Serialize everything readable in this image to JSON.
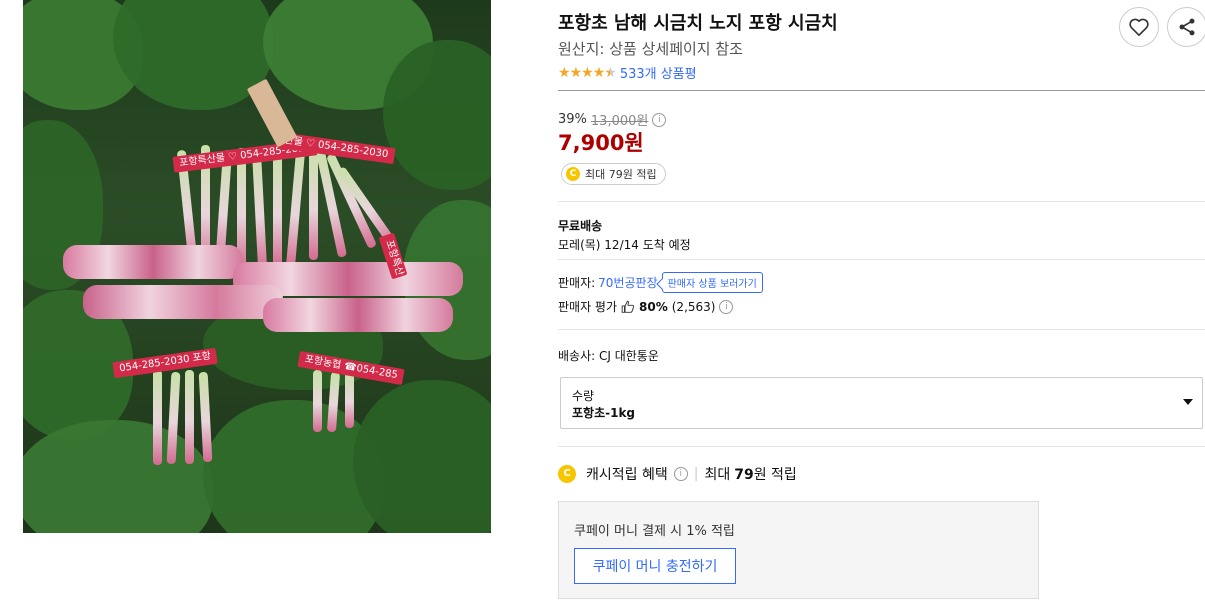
{
  "product": {
    "title": "포항초 남해 시금치 노지 포항 시금치",
    "origin": "원산지: 상품 상세페이지 참조",
    "rating_stars": "★★★★★",
    "review_count": "533개 상품평",
    "rating": 4.5
  },
  "price": {
    "discount_rate": "39%",
    "original_price": "13,000원",
    "sale_price": "7,900원",
    "reward_label": "최대 79원 적립",
    "coin_letter": "C"
  },
  "shipping": {
    "type": "무료배송",
    "arrival": "모레(목) 12/14 도착 예정"
  },
  "seller": {
    "label": "판매자:",
    "name": "70번공판장",
    "view_products": "판매자 상품 보러가기",
    "rating_label": "판매자 평가",
    "rating_percent": "80%",
    "rating_count": "(2,563)"
  },
  "carrier": "배송사: CJ 대한통운",
  "option": {
    "label": "수량",
    "value": "포항초-1kg"
  },
  "cash_reward": {
    "title": "캐시적립 혜택",
    "max": "최대",
    "amount": "79",
    "suffix": "원 적립",
    "coupay_desc": "쿠페이 머니 결제 시 1% 적립",
    "charge_button": "쿠페이 머니 충전하기"
  },
  "image_text": {
    "band1": "포항특산물 ♡ 054-285-2030",
    "band2": "산물 ♡ 054-285-2030",
    "band3": "054-285-2030 포항",
    "band4": "포항농협 ☎054-285",
    "band5": "포항특산"
  },
  "colors": {
    "accent": "#346aff",
    "price": "#ae0000",
    "star": "#f5a623",
    "coin": "#f7c600"
  }
}
